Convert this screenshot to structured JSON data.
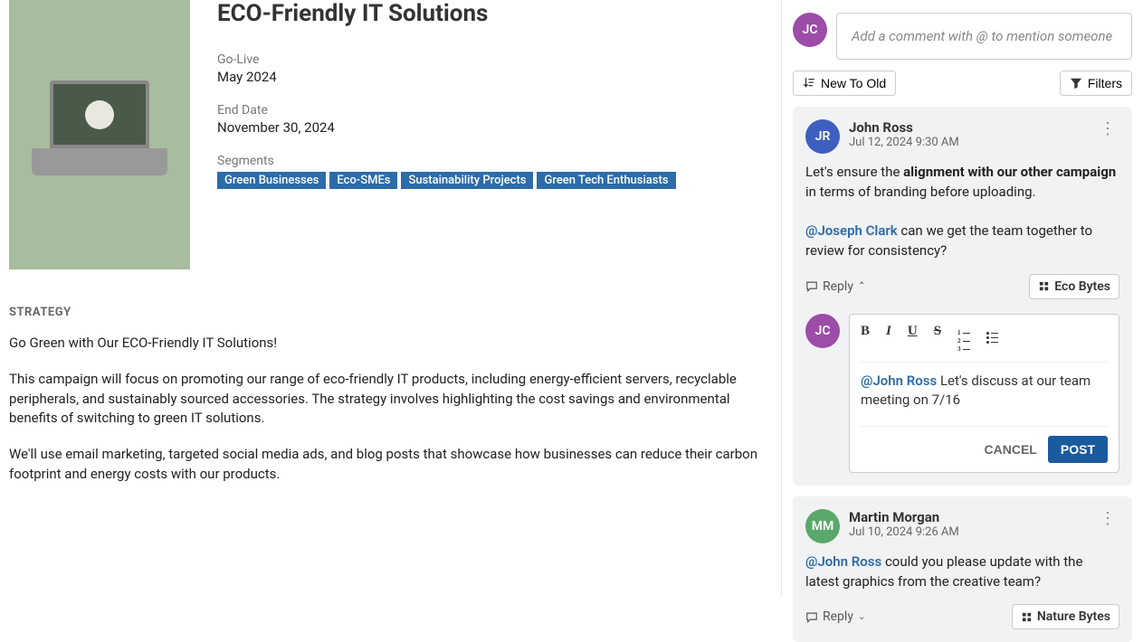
{
  "campaign": {
    "title": "ECO-Friendly IT Solutions",
    "go_live_label": "Go-Live",
    "go_live_value": "May 2024",
    "end_date_label": "End Date",
    "end_date_value": "November 30, 2024",
    "segments_label": "Segments",
    "segments": [
      "Green Businesses",
      "Eco-SMEs",
      "Sustainability Projects",
      "Green Tech Enthusiasts"
    ]
  },
  "strategy": {
    "heading": "STRATEGY",
    "p1": "Go Green with Our ECO-Friendly IT Solutions!",
    "p2": "This campaign will focus on promoting our range of eco-friendly IT products, including energy-efficient servers, recyclable peripherals, and sustainably sourced accessories. The strategy involves highlighting the cost savings and environmental benefits of switching to green IT solutions.",
    "p3": "We'll use email marketing, targeted social media ads, and blog posts that showcase how businesses can reduce their carbon footprint and energy costs with our products."
  },
  "comments": {
    "current_user_initials": "JC",
    "placeholder": "Add a comment with @ to mention someone",
    "sort_label": "New To Old",
    "filters_label": "Filters",
    "reply_label": "Reply",
    "cancel_label": "CANCEL",
    "post_label": "POST",
    "c1": {
      "initials": "JR",
      "author": "John Ross",
      "time": "Jul 12, 2024 9:30 AM",
      "body_1": "Let's ensure the ",
      "body_strong": "alignment with our other campaign",
      "body_2": " in terms of branding before uploading.",
      "mention": "@Joseph Clark",
      "body_3": " can we get the team together to review for consistency?",
      "tag": "Eco Bytes"
    },
    "reply_draft": {
      "initials": "JC",
      "mention": "@John Ross",
      "text": " Let's discuss at our team meeting on 7/16"
    },
    "c2": {
      "initials": "MM",
      "author": "Martin Morgan",
      "time": "Jul 10, 2024 9:26 AM",
      "mention": "@John Ross",
      "body": " could you please update with the latest graphics from the creative team?",
      "tag": "Nature Bytes"
    }
  }
}
